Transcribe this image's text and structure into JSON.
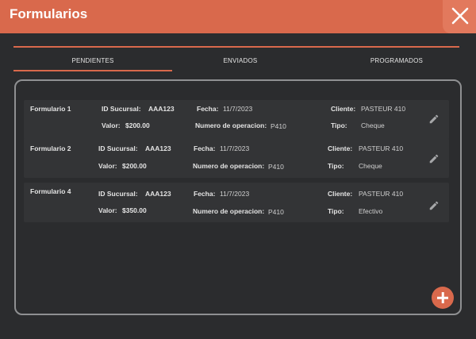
{
  "header": {
    "title": "Formularios"
  },
  "tabs": [
    {
      "label": "PENDIENTES",
      "active": true
    },
    {
      "label": "ENVIADOS",
      "active": false
    },
    {
      "label": "PROGRAMADOS",
      "active": false
    }
  ],
  "labels": {
    "id_sucursal": "ID Sucursal:",
    "fecha": "Fecha:",
    "cliente": "Cliente:",
    "valor": "Valor:",
    "numero": "Numero de operacion:",
    "tipo": "Tipo:"
  },
  "forms": [
    {
      "name": "Formulario 1",
      "id_sucursal": "AAA123",
      "fecha": "11/7/2023",
      "cliente": "PASTEUR 410",
      "valor": "$200.00",
      "numero": "P410",
      "tipo": "Cheque"
    },
    {
      "name": "Formulario 2",
      "id_sucursal": "AAA123",
      "fecha": "11/7/2023",
      "cliente": "PASTEUR 410",
      "valor": "$200.00",
      "numero": "P410",
      "tipo": "Cheque"
    },
    {
      "name": "Formulario 4",
      "id_sucursal": "AAA123",
      "fecha": "11/7/2023",
      "cliente": "PASTEUR 410",
      "valor": "$350.00",
      "numero": "P410",
      "tipo": "Efectivo"
    }
  ],
  "colors": {
    "accent": "#d9694c",
    "background": "#2b2c2e",
    "card": "#333436"
  },
  "icons": {
    "close": "close-icon",
    "edit": "pencil-icon",
    "add": "plus-icon"
  }
}
